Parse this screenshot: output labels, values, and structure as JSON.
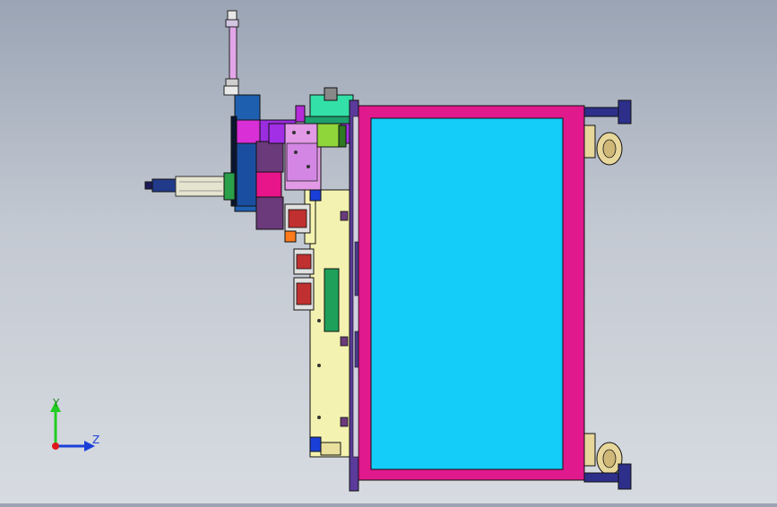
{
  "view": {
    "background_top": "#9aa4b4",
    "background_bottom": "#d7dbe1"
  },
  "axes_triad": {
    "y_label": "Y",
    "z_label": "Z",
    "y_color": "#22cc22",
    "z_color": "#1a3fd8",
    "x_color": "#dd1a1a"
  },
  "model": {
    "frame_color": "#e0198c",
    "panel_color": "#14cdf8",
    "base_plate_color": "#f4f2b0",
    "foot_color": "#2d2f8a",
    "caster_color": "#e8d79a"
  }
}
